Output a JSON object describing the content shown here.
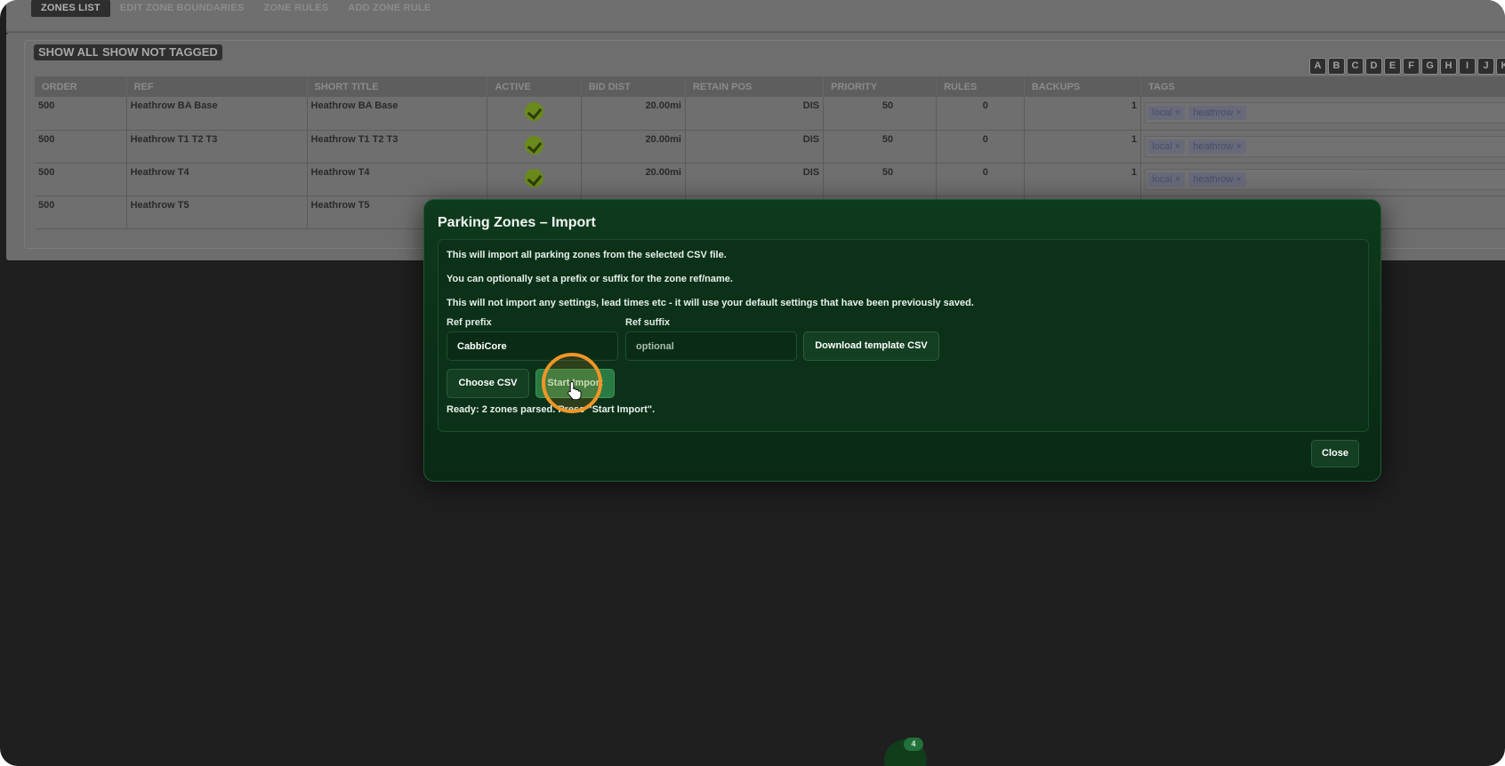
{
  "nav": {
    "tabs": [
      "ZONES LIST",
      "EDIT ZONE BOUNDARIES",
      "ZONE RULES",
      "ADD ZONE RULE"
    ],
    "active_tab": "ZONES LIST"
  },
  "filters": {
    "show_all": "SHOW ALL",
    "show_not_tagged": "SHOW NOT TAGGED"
  },
  "alphabet": [
    "A",
    "B",
    "C",
    "D",
    "E",
    "F",
    "G",
    "H",
    "I",
    "J",
    "K"
  ],
  "table": {
    "columns": [
      "ORDER",
      "REF",
      "SHORT TITLE",
      "ACTIVE",
      "BID DIST",
      "RETAIN POS",
      "PRIORITY",
      "RULES",
      "BACKUPS",
      "TAGS"
    ],
    "rows": [
      {
        "order": "500",
        "ref": "Heathrow BA Base",
        "short_title": "Heathrow BA Base",
        "active": true,
        "bid_dist": "20.00mi",
        "retain_pos": "DIS",
        "priority": "50",
        "rules": "0",
        "backups": "1",
        "tags": [
          "local",
          "heathrow"
        ]
      },
      {
        "order": "500",
        "ref": "Heathrow T1 T2 T3",
        "short_title": "Heathrow T1 T2 T3",
        "active": true,
        "bid_dist": "20.00mi",
        "retain_pos": "DIS",
        "priority": "50",
        "rules": "0",
        "backups": "1",
        "tags": [
          "local",
          "heathrow"
        ]
      },
      {
        "order": "500",
        "ref": "Heathrow T4",
        "short_title": "Heathrow T4",
        "active": true,
        "bid_dist": "20.00mi",
        "retain_pos": "DIS",
        "priority": "50",
        "rules": "0",
        "backups": "1",
        "tags": [
          "local",
          "heathrow"
        ]
      },
      {
        "order": "500",
        "ref": "Heathrow T5",
        "short_title": "Heathrow T5",
        "active": null,
        "bid_dist": "",
        "retain_pos": "",
        "priority": "",
        "rules": "",
        "backups": "",
        "tags": []
      }
    ],
    "tag_remove_glyph": "×"
  },
  "fab": {
    "badge": "4"
  },
  "modal": {
    "title": "Parking Zones – Import",
    "info_1": "This will import all parking zones from the selected CSV file.",
    "info_2": "You can optionally set a prefix or suffix for the zone ref/name.",
    "info_3": "This will not import any settings, lead times etc - it will use your default settings that have been previously saved.",
    "ref_prefix_label": "Ref prefix",
    "ref_prefix_value": "CabbiCore",
    "ref_suffix_label": "Ref suffix",
    "ref_suffix_placeholder": "optional",
    "download_template": "Download template CSV",
    "choose_csv": "Choose CSV",
    "start_import": "Start Import",
    "status": "Ready: 2 zones parsed. Press \"Start Import\".",
    "close": "Close"
  },
  "colors": {
    "modal_bg": "#0b2f17",
    "primary_button": "#2a7a44",
    "click_highlight": "#f09627",
    "active_check": "#6a8a1c"
  }
}
